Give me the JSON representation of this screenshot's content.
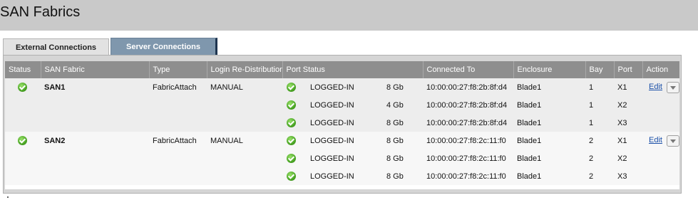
{
  "page": {
    "title": "SAN Fabrics"
  },
  "tabs": [
    {
      "label": "External Connections",
      "active": true
    },
    {
      "label": "Server Connections",
      "active": false
    }
  ],
  "table": {
    "headers": [
      "Status",
      "SAN Fabric",
      "Type",
      "Login Re-Distribution",
      "Port Status",
      "Connected To",
      "Enclosure",
      "Bay",
      "Port",
      "Action"
    ],
    "fabrics": [
      {
        "status": "ok",
        "name": "SAN1",
        "type": "FabricAttach",
        "login": "MANUAL",
        "action": "Edit",
        "ports": [
          {
            "state": "LOGGED-IN",
            "speed": "8 Gb",
            "connected_to": "10:00:00:27:f8:2b:8f:d4",
            "enclosure": "Blade1",
            "bay": "1",
            "port": "X1"
          },
          {
            "state": "LOGGED-IN",
            "speed": "4 Gb",
            "connected_to": "10:00:00:27:f8:2b:8f:d4",
            "enclosure": "Blade1",
            "bay": "1",
            "port": "X2"
          },
          {
            "state": "LOGGED-IN",
            "speed": "8 Gb",
            "connected_to": "10:00:00:27:f8:2b:8f:d4",
            "enclosure": "Blade1",
            "bay": "1",
            "port": "X3"
          }
        ]
      },
      {
        "status": "ok",
        "name": "SAN2",
        "type": "FabricAttach",
        "login": "MANUAL",
        "action": "Edit",
        "ports": [
          {
            "state": "LOGGED-IN",
            "speed": "8 Gb",
            "connected_to": "10:00:00:27:f8:2c:11:f0",
            "enclosure": "Blade1",
            "bay": "2",
            "port": "X1"
          },
          {
            "state": "LOGGED-IN",
            "speed": "8 Gb",
            "connected_to": "10:00:00:27:f8:2c:11:f0",
            "enclosure": "Blade1",
            "bay": "2",
            "port": "X2"
          },
          {
            "state": "LOGGED-IN",
            "speed": "8 Gb",
            "connected_to": "10:00:00:27:f8:2c:11:f0",
            "enclosure": "Blade1",
            "bay": "2",
            "port": "X3"
          }
        ]
      }
    ]
  },
  "colors": {
    "title_bar": "#c9c9c9",
    "header_bg": "#8e8e8e",
    "active_tab": "#e2e2e2",
    "inactive_tab": "#7f97ad",
    "status_ok": "#4aa524",
    "link": "#1a4fa8"
  },
  "icons": {
    "status_ok": "check-circle-icon",
    "action_menu": "chevron-down-icon"
  }
}
